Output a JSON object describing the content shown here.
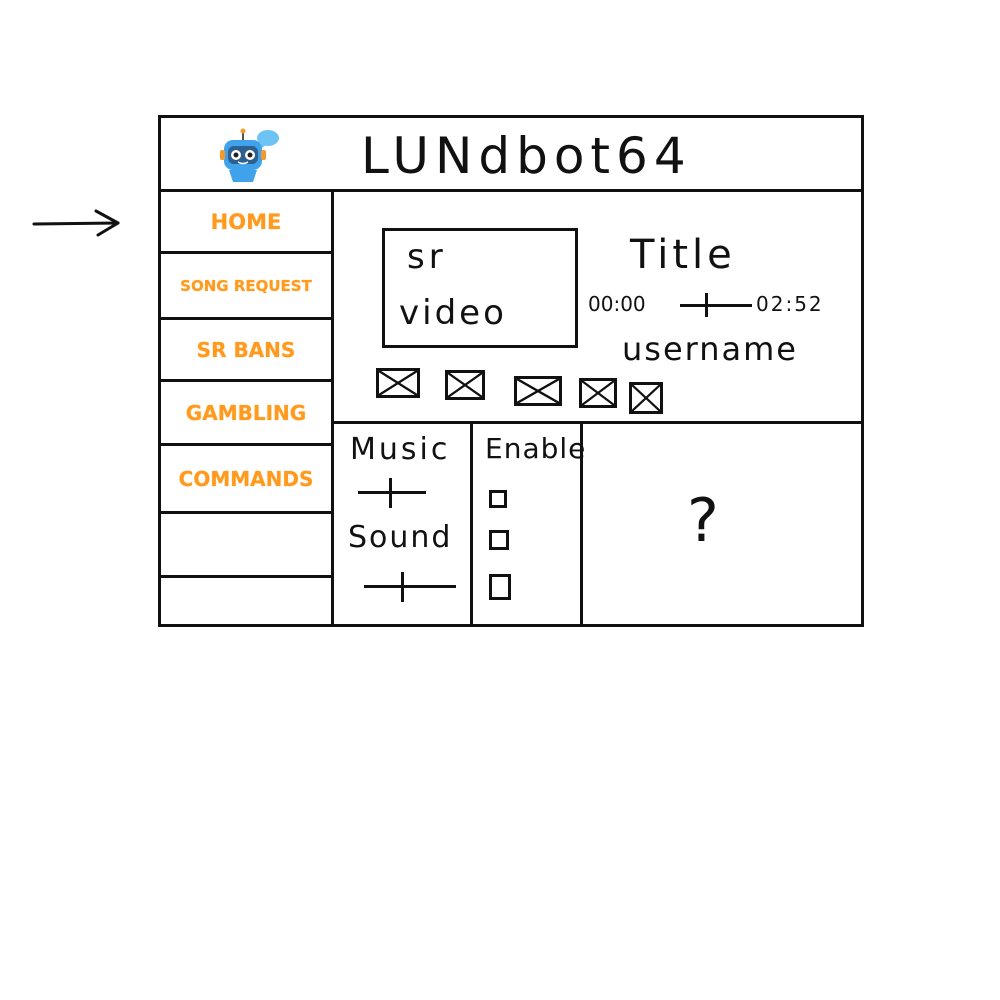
{
  "app": {
    "title": "LUNdbot64"
  },
  "sidebar": {
    "items": [
      {
        "label": "HOME"
      },
      {
        "label": "SONG REQUEST"
      },
      {
        "label": "SR BANS"
      },
      {
        "label": "GAMBLING"
      },
      {
        "label": "COMMANDS"
      }
    ]
  },
  "player": {
    "video_line1": "sr",
    "video_line2": "video",
    "song_title": "Title",
    "time_current": "00:00",
    "time_total": "02:52",
    "progress": 0.35,
    "requester": "username",
    "control_icons": [
      "placeholder-icon",
      "placeholder-icon",
      "placeholder-icon",
      "placeholder-icon",
      "placeholder-icon"
    ]
  },
  "settings": {
    "music_label": "Music",
    "sound_label": "Sound",
    "music_level": 0.45,
    "sound_level": 0.4,
    "enable_label": "Enable",
    "enable_checkboxes": [
      false,
      false,
      false
    ]
  },
  "unknown_panel": {
    "mark": "?"
  },
  "colors": {
    "nav_text": "#ff9a1f",
    "ink": "#111111",
    "robot_blue": "#3fa2ea",
    "bubble": "#6ec3f5"
  }
}
